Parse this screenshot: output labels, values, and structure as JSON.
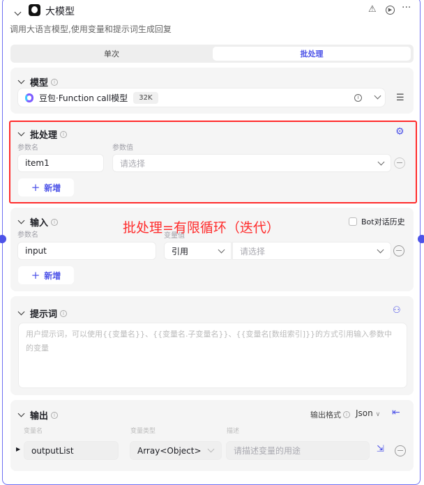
{
  "header": {
    "title": "大模型",
    "description": "调用大语言模型,使用变量和提示词生成回复"
  },
  "tabs": [
    {
      "label": "单次"
    },
    {
      "label": "批处理",
      "active": true
    }
  ],
  "model": {
    "title": "模型",
    "name": "豆包·Function call模型",
    "context": "32K"
  },
  "batch": {
    "title": "批处理",
    "param_name_label": "参数名",
    "param_value_label": "参数值",
    "param_name": "item1",
    "param_value_placeholder": "请选择",
    "add_label": "新增"
  },
  "annotation": "批处理=有限循环（迭代）",
  "input": {
    "title": "输入",
    "history_label": "Bot对话历史",
    "param_name_label": "参数名",
    "var_value_label": "变量值",
    "param_name": "input",
    "ref_type": "引用",
    "value_placeholder": "请选择",
    "add_label": "新增"
  },
  "prompt": {
    "title": "提示词",
    "placeholder": "用户提示词，可以使用{{变量名}}、{{变量名.子变量名}}、{{变量名[数组索引]}}的方式引用输入参数中的变量"
  },
  "output": {
    "title": "输出",
    "format_label": "输出格式",
    "format_value": "Json",
    "col_name": "变量名",
    "col_type": "变量类型",
    "col_desc": "描述",
    "var_name": "outputList",
    "var_type": "Array<Object>",
    "desc_placeholder": "请描述变量的用途"
  },
  "colors": {
    "accent": "#4d53e8",
    "highlight": "#ff2b2b"
  }
}
